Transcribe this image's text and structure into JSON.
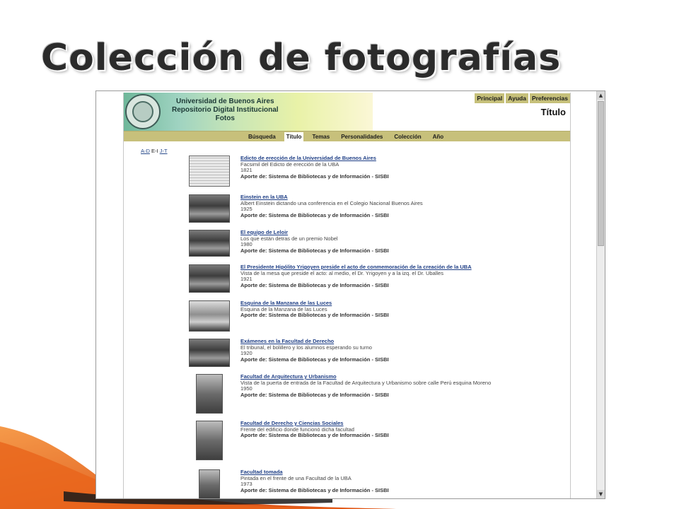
{
  "slide": {
    "title": "Colección de fotografías"
  },
  "site": {
    "banner_lines": [
      "Universidad de Buenos Aires",
      "Repositorio Digital Institucional",
      "Fotos"
    ],
    "top_menu": [
      "Principal",
      "Ayuda",
      "Preferencias"
    ],
    "page_title": "Título",
    "nav_tabs": [
      "Búsqueda",
      "Título",
      "Temas",
      "Personalidades",
      "Colección",
      "Año"
    ],
    "active_tab": "Título",
    "alpha_index": {
      "link1": "A-D",
      "current": "E-I",
      "link2": "J-T"
    },
    "items": [
      {
        "title": "Edicto de erección de la Universidad de Buenos Aires",
        "description": "Facsimil del Edicto de erección de la UBA",
        "year": "1821",
        "credit": "Aporte de: Sistema de Bibliotecas y de Información - SISBI"
      },
      {
        "title": "Einstein en la UBA",
        "description": "Albert Einstein dictando una conferencia en el Colegio Nacional Buenos Aires",
        "year": "1925",
        "credit": "Aporte de: Sistema de Bibliotecas y de Información - SISBI"
      },
      {
        "title": "El equipo de Leloir",
        "description": "Los que están detras de un premio Nobel",
        "year": "1980",
        "credit": "Aporte de: Sistema de Bibliotecas y de Información - SISBI"
      },
      {
        "title": "El Presidente Hipólito Yrigoyen preside el acto de conmemoración de la creación de la UBA",
        "description": "Vista de la mesa que preside el acto: al medio, el Dr. Yrigoyen y a la izq. el Dr. Uballes",
        "year": "1921",
        "credit": "Aporte de: Sistema de Bibliotecas y de Información - SISBI"
      },
      {
        "title": "Esquina de la Manzana de las Luces",
        "description": "Esquina de la Manzana de las Luces",
        "year": "",
        "credit": "Aporte de: Sistema de Bibliotecas y de Información - SISBI"
      },
      {
        "title": "Exámenes en la Facultad de Derecho",
        "description": "El tribunal, el bolillero y los alumnos esperando su turno",
        "year": "1920",
        "credit": "Aporte de: Sistema de Bibliotecas y de Información - SISBI"
      },
      {
        "title": "Facultad de Arquitectura y Urbanismo",
        "description": "Vista de la puerta de entrada de la Facultad de Arquitectura y Urbanismo sobre calle Perú esquina Moreno",
        "year": "1950",
        "credit": "Aporte de: Sistema de Bibliotecas y de Información - SISBI"
      },
      {
        "title": "Facultad de Derecho y Ciencias Sociales",
        "description": "Frente del edificio donde funcionó dicha facultad",
        "year": "",
        "credit": "Aporte de: Sistema de Bibliotecas y de Información - SISBI"
      },
      {
        "title": "Facultad tomada",
        "description": "Pintada en el frente de una Facultad de la UBA",
        "year": "1973",
        "credit": "Aporte de: Sistema de Bibliotecas y de Información - SISBI"
      }
    ]
  },
  "colors": {
    "nav_bar": "#c7c07b",
    "link": "#1f3f86",
    "swoosh": "#e8641a"
  }
}
